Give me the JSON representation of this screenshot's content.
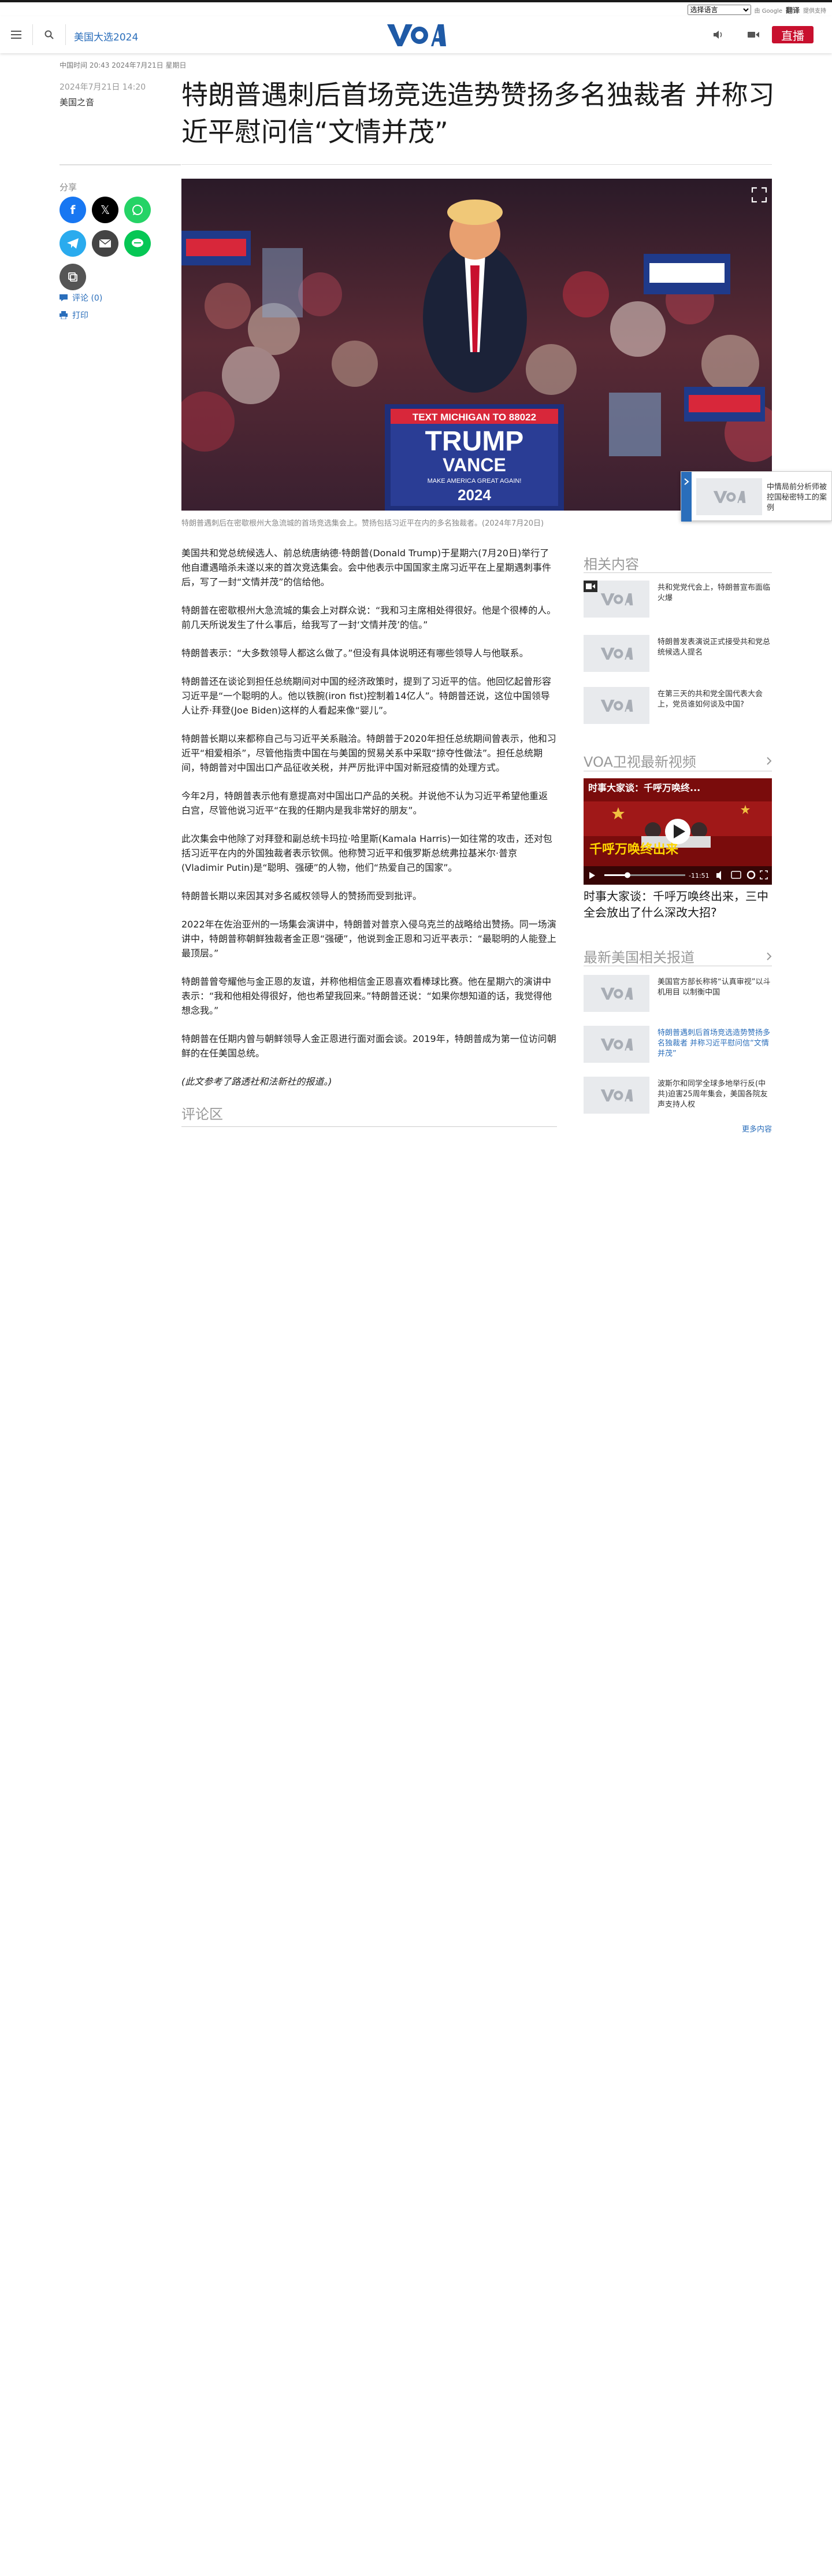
{
  "translate": {
    "select_value": "选择语言",
    "powered_by": "由 Google",
    "brand": "翻译",
    "suffix": "提供支持"
  },
  "header": {
    "section_link": "美国大选2024",
    "logo_text": "VOA",
    "live_label": "直播"
  },
  "article": {
    "dateline": "中国时间 20:43 2024年7月21日 星期日",
    "pub_date": "2024年7月21日 14:20",
    "author": "美国之音",
    "title": "特朗普遇刺后首场竞选造势赞扬多名独裁者 并称习近平慰问信“文情并茂”",
    "caption": "特朗普遇刺后在密歇根州大急流城的首场竞选集会上。赞扬包括习近平在内的多名独裁者。(2024年7月20日)",
    "paragraphs": [
      "美国共和党总统候选人、前总统唐纳德·特朗普(Donald Trump)于星期六(7月20日)举行了他自遭遇暗杀未遂以来的首次竞选集会。会中他表示中国国家主席习近平在上星期遇刺事件后，写了一封“文情并茂”的信给他。",
      "特朗普在密歇根州大急流城的集会上对群众说：“我和习主席相处得很好。他是个很棒的人。前几天所说发生了什么事后，给我写了一封‘文情并茂’的信。”",
      "特朗普表示：“大多数领导人都这么做了。”但没有具体说明还有哪些领导人与他联系。",
      "特朗普还在谈论到担任总统期间对中国的经济政策时，提到了习近平的信。他回忆起曾形容习近平是“一个聪明的人。他以铁腕(iron fist)控制着14亿人”。特朗普还说，这位中国领导人让乔·拜登(Joe Biden)这样的人看起来像“婴儿”。",
      "特朗普长期以来都称自己与习近平关系融洽。特朗普于2020年担任总统期间曾表示，他和习近平“相爱相杀”，尽管他指责中国在与美国的贸易关系中采取“掠夺性做法”。担任总统期间，特朗普对中国出口产品征收关税，并严厉批评中国对新冠疫情的处理方式。",
      "今年2月，特朗普表示他有意提高对中国出口产品的关税。并说他不认为习近平希望他重返白宫，尽管他说习近平“在我的任期内是我非常好的朋友”。",
      "此次集会中他除了对拜登和副总统卡玛拉·哈里斯(Kamala Harris)一如往常的攻击，还对包括习近平在内的外国独裁者表示钦佩。他称赞习近平和俄罗斯总统弗拉基米尔·普京(Vladimir Putin)是“聪明、强硬”的人物，他们“热爱自己的国家”。",
      "特朗普长期以来因其对多名威权领导人的赞扬而受到批评。",
      "2022年在佐治亚州的一场集会演讲中，特朗普对普京入侵乌克兰的战略给出赞扬。同一场演讲中，特朗普称朝鲜独裁者金正恩“强硬”，他说到金正恩和习近平表示：“最聪明的人能登上最顶层。”",
      "特朗普曾夸耀他与金正恩的友谊，并称他相信金正恩喜欢看棒球比赛。他在星期六的演讲中表示：“我和他相处得很好，他也希望我回来。”特朗普还说：“如果你想知道的话，我觉得他想念我。”",
      "特朗普在任期内曾与朝鲜领导人金正恩进行面对面会谈。2019年，特朗普成为第一位访问朝鲜的在任美国总统。",
      "(此文参考了路透社和法新社的报道。)"
    ],
    "comments_heading": "评论区"
  },
  "hero_sign": {
    "top_line": "TEXT MICHIGAN TO 88022",
    "name1": "TRUMP",
    "name2": "VANCE",
    "slogan": "MAKE AMERICA GREAT AGAIN!",
    "year": "2024"
  },
  "sidebar_left": {
    "share_label": "分享",
    "comments_link": "评论 (0)",
    "print_link": "打印"
  },
  "related": {
    "heading": "相关内容",
    "items": [
      {
        "title": "共和党党代会上，特朗普宣布面临火爆"
      },
      {
        "title": "特朗普发表演说正式接受共和党总统候选人提名"
      },
      {
        "title": "在第三天的共和党全国代表大会上，党员谁如何谈及中国?"
      }
    ]
  },
  "video_section": {
    "heading": "VOA卫视最新视频",
    "overlay_title": "时事大家谈：千呼万唤终...",
    "banner_text": "千呼万唤终出来",
    "time": "-11:51",
    "title": "时事大家谈：千呼万唤终出来，三中全会放出了什么深改大招?"
  },
  "latest_us": {
    "heading": "最新美国相关报道",
    "items": [
      {
        "title": "美国官方部长称将“认真审视”以斗机用目 以制衡中国"
      },
      {
        "title": "特朗普遇刺后首场竞选造势赞扬多名独裁者 并称习近平慰问信“文情并茂”"
      },
      {
        "title": "波斯尔和同学全球多地举行反(中共)迫害25周年集会，美国各院友声支持人权"
      }
    ],
    "more_link": "更多内容"
  },
  "float_card": {
    "title": "中情局前分析师被控国秘密特工的案例"
  },
  "colors": {
    "brand_blue": "#2a6ebb",
    "live_red": "#c8102e",
    "facebook": "#1877f2",
    "x": "#000000",
    "whatsapp": "#25d366",
    "telegram": "#2aabee",
    "email": "#444444",
    "line": "#06c755",
    "copy": "#555555"
  },
  "icons": [
    "menu-icon",
    "search-icon",
    "volume-icon",
    "video-camera-icon",
    "fullscreen-icon",
    "comment-icon",
    "print-icon",
    "chevron-right-icon",
    "play-icon"
  ]
}
